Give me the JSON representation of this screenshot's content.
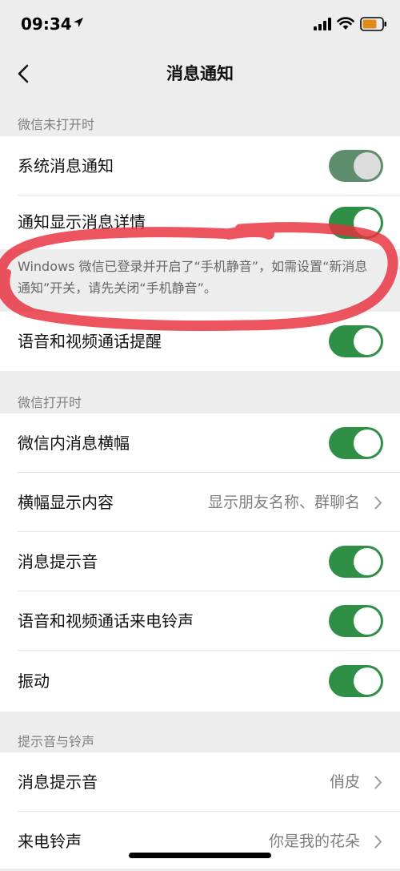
{
  "status": {
    "time": "09:34"
  },
  "nav": {
    "title": "消息通知"
  },
  "section1": {
    "header": "微信未打开时",
    "rows": [
      {
        "label": "系统消息通知",
        "toggle_on": true,
        "disabled": true
      },
      {
        "label": "通知显示消息详情",
        "toggle_on": true,
        "disabled": false
      }
    ],
    "notice": "Windows 微信已登录并开启了“手机静音”，如需设置“新消息通知”开关，请先关闭“手机静音”。",
    "row_after": {
      "label": "语音和视频通话提醒",
      "toggle_on": true
    }
  },
  "section2": {
    "header": "微信打开时",
    "rows": [
      {
        "label": "微信内消息横幅",
        "toggle_on": true
      },
      {
        "label": "横幅显示内容",
        "value": "显示朋友名称、群聊名"
      },
      {
        "label": "消息提示音",
        "toggle_on": true
      },
      {
        "label": "语音和视频通话来电铃声",
        "toggle_on": true
      },
      {
        "label": "振动",
        "toggle_on": true
      }
    ]
  },
  "section3": {
    "header": "提示音与铃声",
    "rows": [
      {
        "label": "消息提示音",
        "value": "俏皮"
      },
      {
        "label": "来电铃声",
        "value": "你是我的花朵"
      }
    ]
  },
  "colors": {
    "toggle_on": "#2f8f46",
    "annotation": "#e8303c",
    "background": "#ededed"
  }
}
